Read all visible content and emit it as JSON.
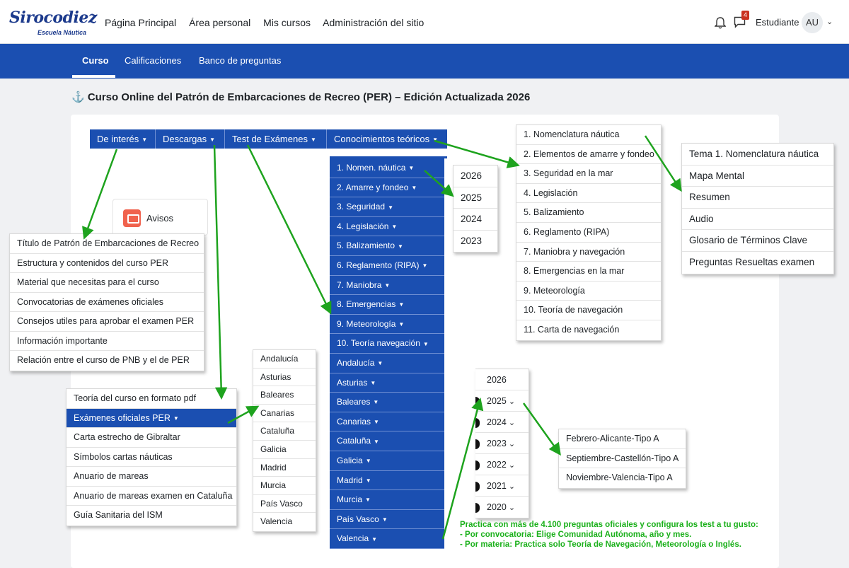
{
  "brand": {
    "name": "Sirocodiez",
    "sub": "Escuela Náutica"
  },
  "topnav": [
    "Página Principal",
    "Área personal",
    "Mis cursos",
    "Administración del sitio"
  ],
  "user": {
    "notif_count": "4",
    "name": "Estudiante",
    "initials": "AU"
  },
  "course_tabs": [
    "Curso",
    "Calificaciones",
    "Banco de preguntas"
  ],
  "page_title": "⚓ Curso Online del Patrón de Embarcaciones de Recreo (PER) – Edición Actualizada 2026",
  "menu_bar": [
    "De interés",
    "Descargas",
    "Test de Exámenes",
    "Conocimientos teóricos"
  ],
  "avisos": "Avisos",
  "interes_items": [
    "Título de Patrón de Embarcaciones de Recreo",
    "Estructura y contenidos del curso PER",
    "Material que necesitas para el curso",
    "Convocatorias de exámenes oficiales",
    "Consejos utiles para aprobar el examen PER",
    "Información importante",
    "Relación entre el curso de PNB y el de PER"
  ],
  "descargas_items": [
    "Teoría del curso en formato pdf",
    "Exámenes oficiales PER",
    "Carta estrecho de Gibraltar",
    "Símbolos cartas náuticas",
    "Anuario de mareas",
    "Anuario de mareas examen en Cataluña",
    "Guía Sanitaria del ISM"
  ],
  "regions": [
    "Andalucía",
    "Asturias",
    "Baleares",
    "Canarias",
    "Cataluña",
    "Galicia",
    "Madrid",
    "Murcia",
    "País Vasco",
    "Valencia"
  ],
  "test_items": [
    "1. Nomen. náutica",
    "2. Amarre y fondeo",
    "3. Seguridad",
    "4. Legislación",
    "5. Balizamiento",
    "6. Reglamento (RIPA)",
    "7. Maniobra",
    "8. Emergencias",
    "9. Meteorología",
    "10. Teoría navegación",
    "Andalucía",
    "Asturias",
    "Baleares",
    "Canarias",
    "Cataluña",
    "Galicia",
    "Madrid",
    "Murcia",
    "País Vasco",
    "Valencia"
  ],
  "years_top": [
    "2026",
    "2025",
    "2024",
    "2023"
  ],
  "teoria_items": [
    "1. Nomenclatura náutica",
    "2. Elementos de amarre y fondeo",
    "3. Seguridad en la mar",
    "4. Legislación",
    "5. Balizamiento",
    "6. Reglamento (RIPA)",
    "7. Maniobra y navegación",
    "8. Emergencias en la mar",
    "9. Meteorología",
    "10. Teoría de navegación",
    "11. Carta de navegación"
  ],
  "tema_items": [
    "Tema 1. Nomenclatura náutica",
    "Mapa Mental",
    "Resumen",
    "Audio",
    "Glosario de Términos Clave",
    "Preguntas Resueltas examen"
  ],
  "years_exam": [
    "2026",
    "2025",
    "2024",
    "2023",
    "2022",
    "2021",
    "2020"
  ],
  "exams_2025": [
    "Febrero-Alicante-Tipo A",
    "Septiembre-Castellón-Tipo A",
    "Noviembre-Valencia-Tipo A"
  ],
  "footnote": [
    "Practica con más de 4.100 preguntas oficiales y configura los test a tu gusto:",
    "-  Por convocatoria: Elige Comunidad Autónoma, año y mes.",
    "-  Por materia: Practica solo Teoría de Navegación, Meteorología o Inglés."
  ],
  "colors": {
    "primary": "#1b4fb1",
    "arrow": "#1ea31e",
    "footnote": "#1bb01b"
  }
}
